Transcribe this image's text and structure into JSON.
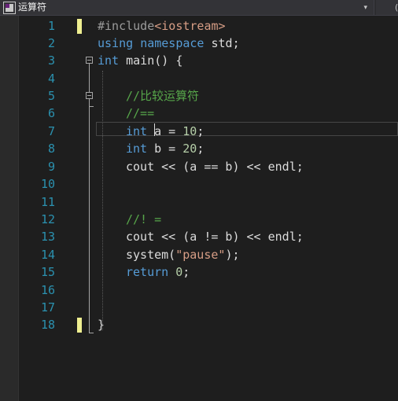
{
  "toolbar": {
    "scope_label": "运算符",
    "dropdown_arrow": "▾",
    "right_glyph": "("
  },
  "colors": {
    "background": "#1e1e1e",
    "line_number": "#2b91af",
    "keyword": "#569cd6",
    "comment": "#57a64a",
    "string": "#d69d85",
    "number": "#b5cea8",
    "change_marker": "#efef91"
  },
  "editor": {
    "line_numbers": [
      "1",
      "2",
      "3",
      "4",
      "5",
      "6",
      "7",
      "8",
      "9",
      "10",
      "11",
      "12",
      "13",
      "14",
      "15",
      "16",
      "17",
      "18"
    ],
    "code": {
      "l1_directive": "#include",
      "l1_header": "<iostream>",
      "l2_using": "using",
      "l2_namespace": "namespace",
      "l2_rest": " std;",
      "l3_int": "int",
      "l3_rest": " main() {",
      "l5_comment": "//比较运算符",
      "l6_comment": "//==",
      "l7_int": "int",
      "l7_mid": " a = ",
      "l7_num": "10",
      "l7_end": ";",
      "l8_int": "int",
      "l8_mid": " b = ",
      "l8_num": "20",
      "l8_end": ";",
      "l9_stmt": "cout << (a == b) << endl;",
      "l12_comment": "//! =",
      "l13_stmt": "cout << (a != b) << endl;",
      "l14_pre": "system(",
      "l14_str": "\"pause\"",
      "l14_post": ");",
      "l15_return": "return",
      "l15_sp": " ",
      "l15_num": "0",
      "l15_end": ";",
      "l18_brace": "}"
    }
  }
}
